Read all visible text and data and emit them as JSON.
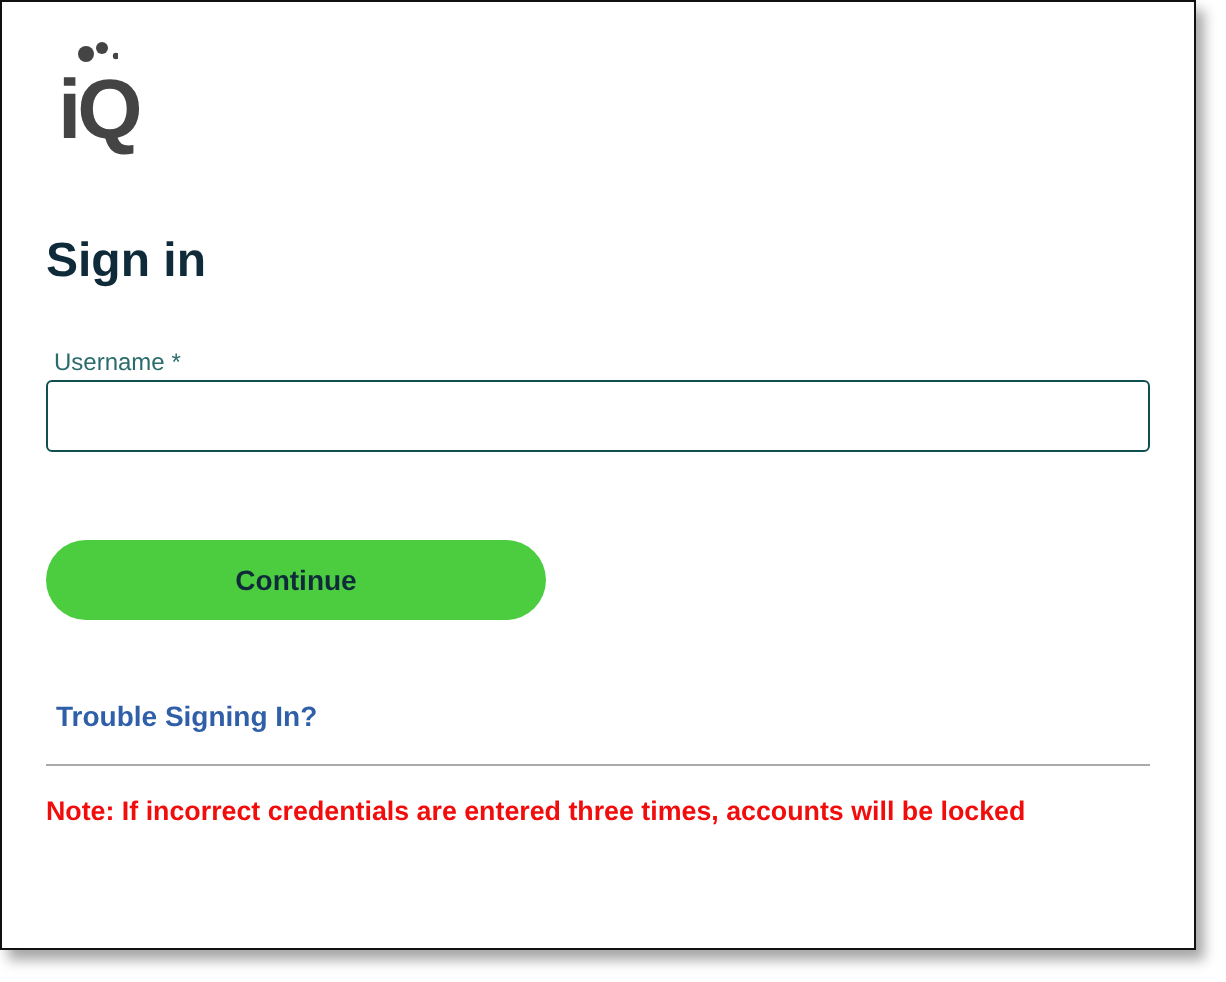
{
  "logo": {
    "text": "iQ"
  },
  "heading": "Sign in",
  "username": {
    "label": "Username *"
  },
  "continue_button": "Continue",
  "help_link": "Trouble Signing In?",
  "note": "Note: If incorrect credentials are entered three times, accounts will be locked"
}
